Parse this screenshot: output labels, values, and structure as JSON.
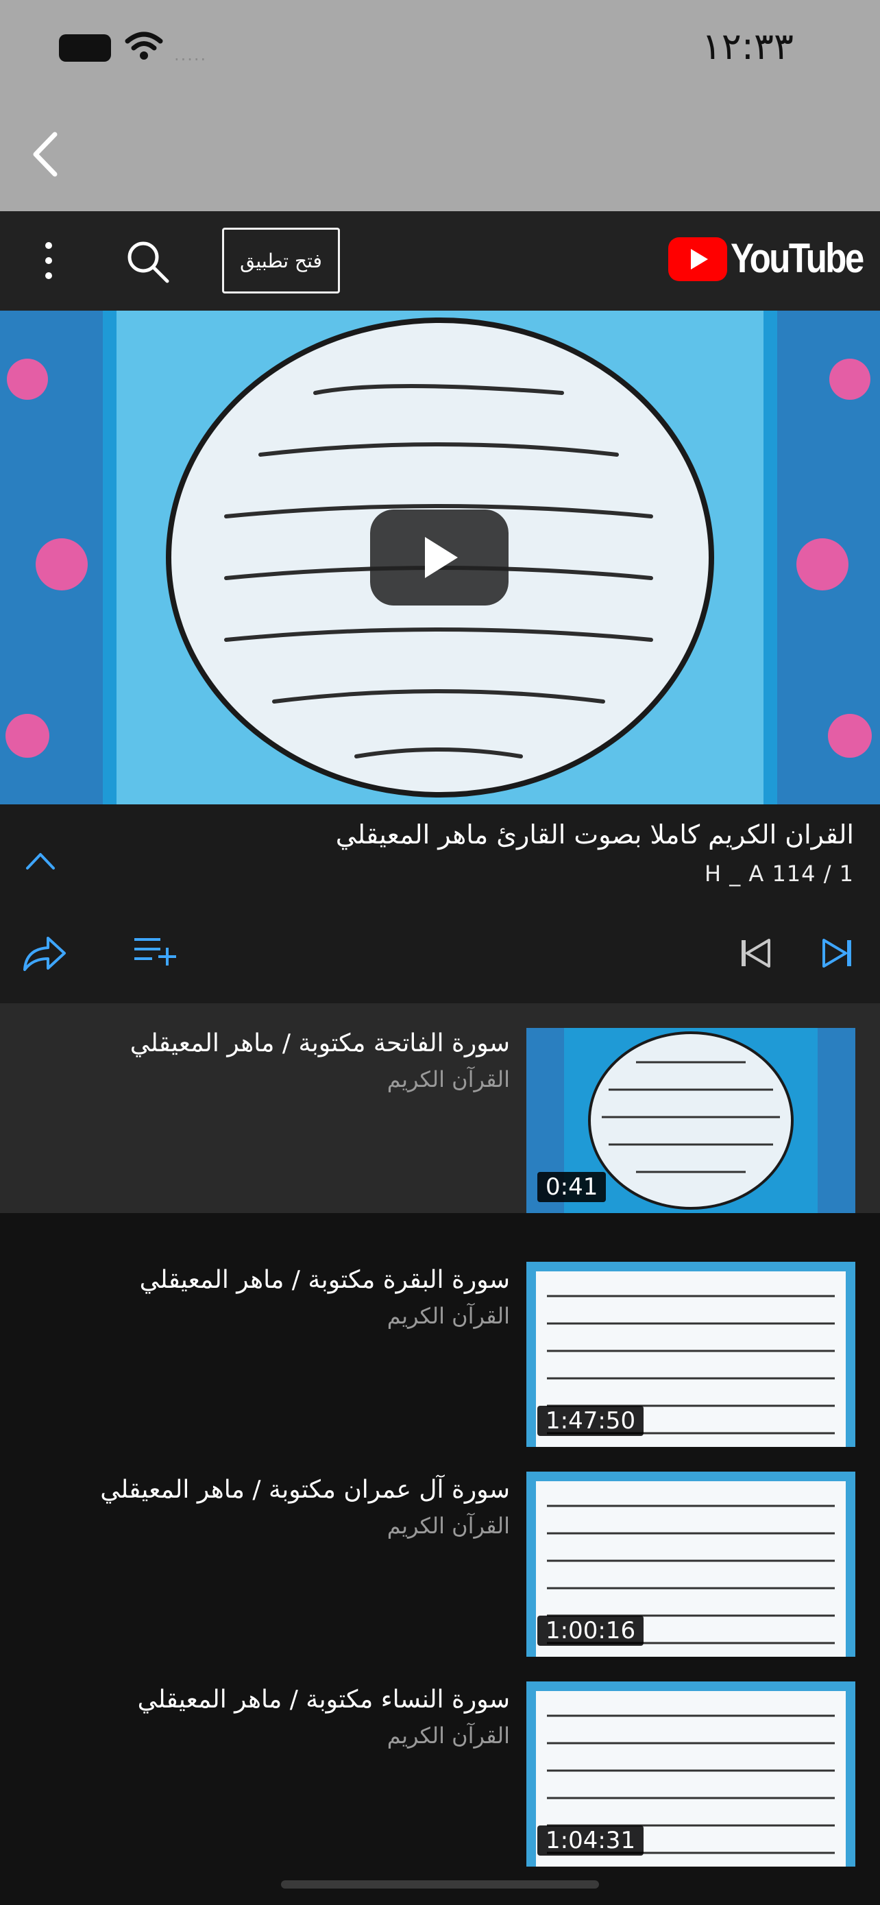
{
  "status_bar": {
    "time": "١٢:٣٣",
    "signal": "....."
  },
  "header": {
    "open_app_label": "فتح تطبيق",
    "logo_text": "YouTube",
    "brand_color": "#ff0000"
  },
  "playlist": {
    "title": "القران الكريم كاملا بصوت القارئ ماهر المعيقلي",
    "meta": "H _ A   114 / 1"
  },
  "items": [
    {
      "title": "سورة الفاتحة مكتوبة / ماهر المعيقلي",
      "channel": "القرآن الكريم",
      "duration": "0:41"
    },
    {
      "title": "سورة البقرة مكتوبة / ماهر المعيقلي",
      "channel": "القرآن الكريم",
      "duration": "1:47:50"
    },
    {
      "title": "سورة آل عمران مكتوبة / ماهر المعيقلي",
      "channel": "القرآن الكريم",
      "duration": "1:00:16"
    },
    {
      "title": "سورة النساء مكتوبة / ماهر المعيقلي",
      "channel": "القرآن الكريم",
      "duration": "1:04:31"
    }
  ],
  "accent_color": "#3ea6ff"
}
